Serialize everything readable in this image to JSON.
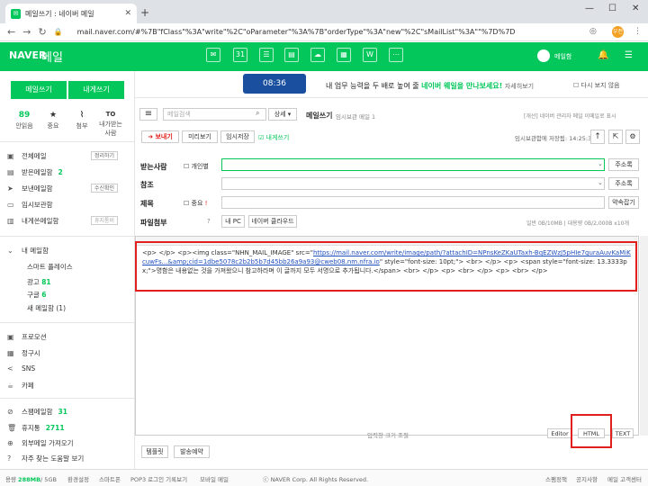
{
  "browser": {
    "tab_title": "메일쓰기 : 네이버 메일",
    "url": "mail.naver.com/#%7B\"fClass\"%3A\"write\"%2C\"oParameter\"%3A%7B\"orderType\"%3A\"new\"%2C\"sMailList\"%3A\"\"%7D%7D",
    "profile": "우전"
  },
  "header": {
    "logo": "NAVER",
    "logo_sub": "메일",
    "user": "메일함"
  },
  "sidebar": {
    "write": "메일쓰기",
    "self_write": "내게쓰기",
    "stats": [
      {
        "n": "89",
        "label": "안읽음"
      },
      {
        "n": "★",
        "label": "중요"
      },
      {
        "n": "⌇",
        "label": "첨부"
      },
      {
        "n": "TO",
        "label": "내가받는사람"
      }
    ],
    "folders": [
      {
        "label": "전체메일",
        "badge": "정리하기"
      },
      {
        "label": "받은메일함",
        "count": "2"
      },
      {
        "label": "보낸메일함",
        "badge": "수신확인"
      },
      {
        "label": "임시보관함"
      },
      {
        "label": "내게쓴메일함",
        "badge": "휴지통비"
      }
    ],
    "my_section": "내 메일함",
    "my_items": [
      {
        "label": "스마트 플레이스"
      },
      {
        "label": "광고",
        "count": "81"
      },
      {
        "label": "구글",
        "count": "6"
      },
      {
        "label": "새 메일함 (1)"
      }
    ],
    "extra": [
      {
        "label": "프로모션"
      },
      {
        "label": "정구시"
      },
      {
        "label": "SNS"
      },
      {
        "label": "카페"
      }
    ],
    "spam": {
      "label": "스팸메일함",
      "count": "31"
    },
    "trash": {
      "label": "휴지통",
      "count": "2711"
    },
    "external": "외부메일 가져오기",
    "help": "자주 찾는 도움말 보기"
  },
  "banner": {
    "time": "08:36",
    "text": "내 업무 능력을 두 배로 높여 줄 ",
    "highlight": "네이버 웨일을 만나보세요!",
    "more": "자세히보기",
    "hide": "다시 보지 않음"
  },
  "search": {
    "placeholder": "메일검색",
    "detail": "상세 ▾"
  },
  "compose": {
    "title": "메일쓰기",
    "temp": "임시보관 메일 1",
    "note": "[개선] 네이버 관리자 메일 이메일로 표시",
    "send": "➜ 보내기",
    "preview": "미리보기",
    "save": "임시저장",
    "self": "☑ 내게쓰기",
    "autosave": "임시보관함에 저장됨: 14:25:31",
    "to_label": "받는사람",
    "individual": "개인별",
    "addr": "주소록",
    "cc_label": "참조",
    "subject_label": "제목",
    "important": "중요",
    "signature": "약속잡기",
    "attach_label": "파일첨부",
    "my_pc": "내 PC",
    "cloud": "네이버 클라우드",
    "limit": "일반 0B/10MB | 대용량 0B/2,000B x10개",
    "code": [
      "<p> </p> <p><img class=\"NHN_MAIL_IMAGE\" src=\"",
      "https://mail.naver.com/write/image/path/?attachID=NPnsKeZKaUTaxh-BqEZWzJ5pHIe7guraAuvKaMiKcuwFs...&amp;cid=1dbe5078c2b2b5b7d45bb26a9a93@cweb08.nm.nfra.io",
      "\" style=\"font-size: 10pt;\"> <br> </p> <p> <span style=\"font-size: 13.3333px;\">명함은 내용없는 것을 가져왔으니 참고하라며 이 글까지 모두 서명으로 추가됩니다.</span> <br> </p> <p> <br> </p> <p> <br> </p>"
    ],
    "resize": "입력창 크기 조절",
    "editor": "Editor",
    "html": "HTML",
    "text": "TEXT",
    "template": "템플릿",
    "reserve": "발송예약"
  },
  "footer": {
    "used": "용량",
    "used_val": "288MB",
    "total": "/ 5GB",
    "settings": "환경설정",
    "smartphone": "스마트폰",
    "pop": "POP3 로그인 기록보기",
    "mobile": "모바일 메일",
    "copy": "ⓒ NAVER Corp. All Rights Reserved.",
    "links": [
      "스팸정책",
      "공지사항",
      "메일 고객센터"
    ]
  }
}
